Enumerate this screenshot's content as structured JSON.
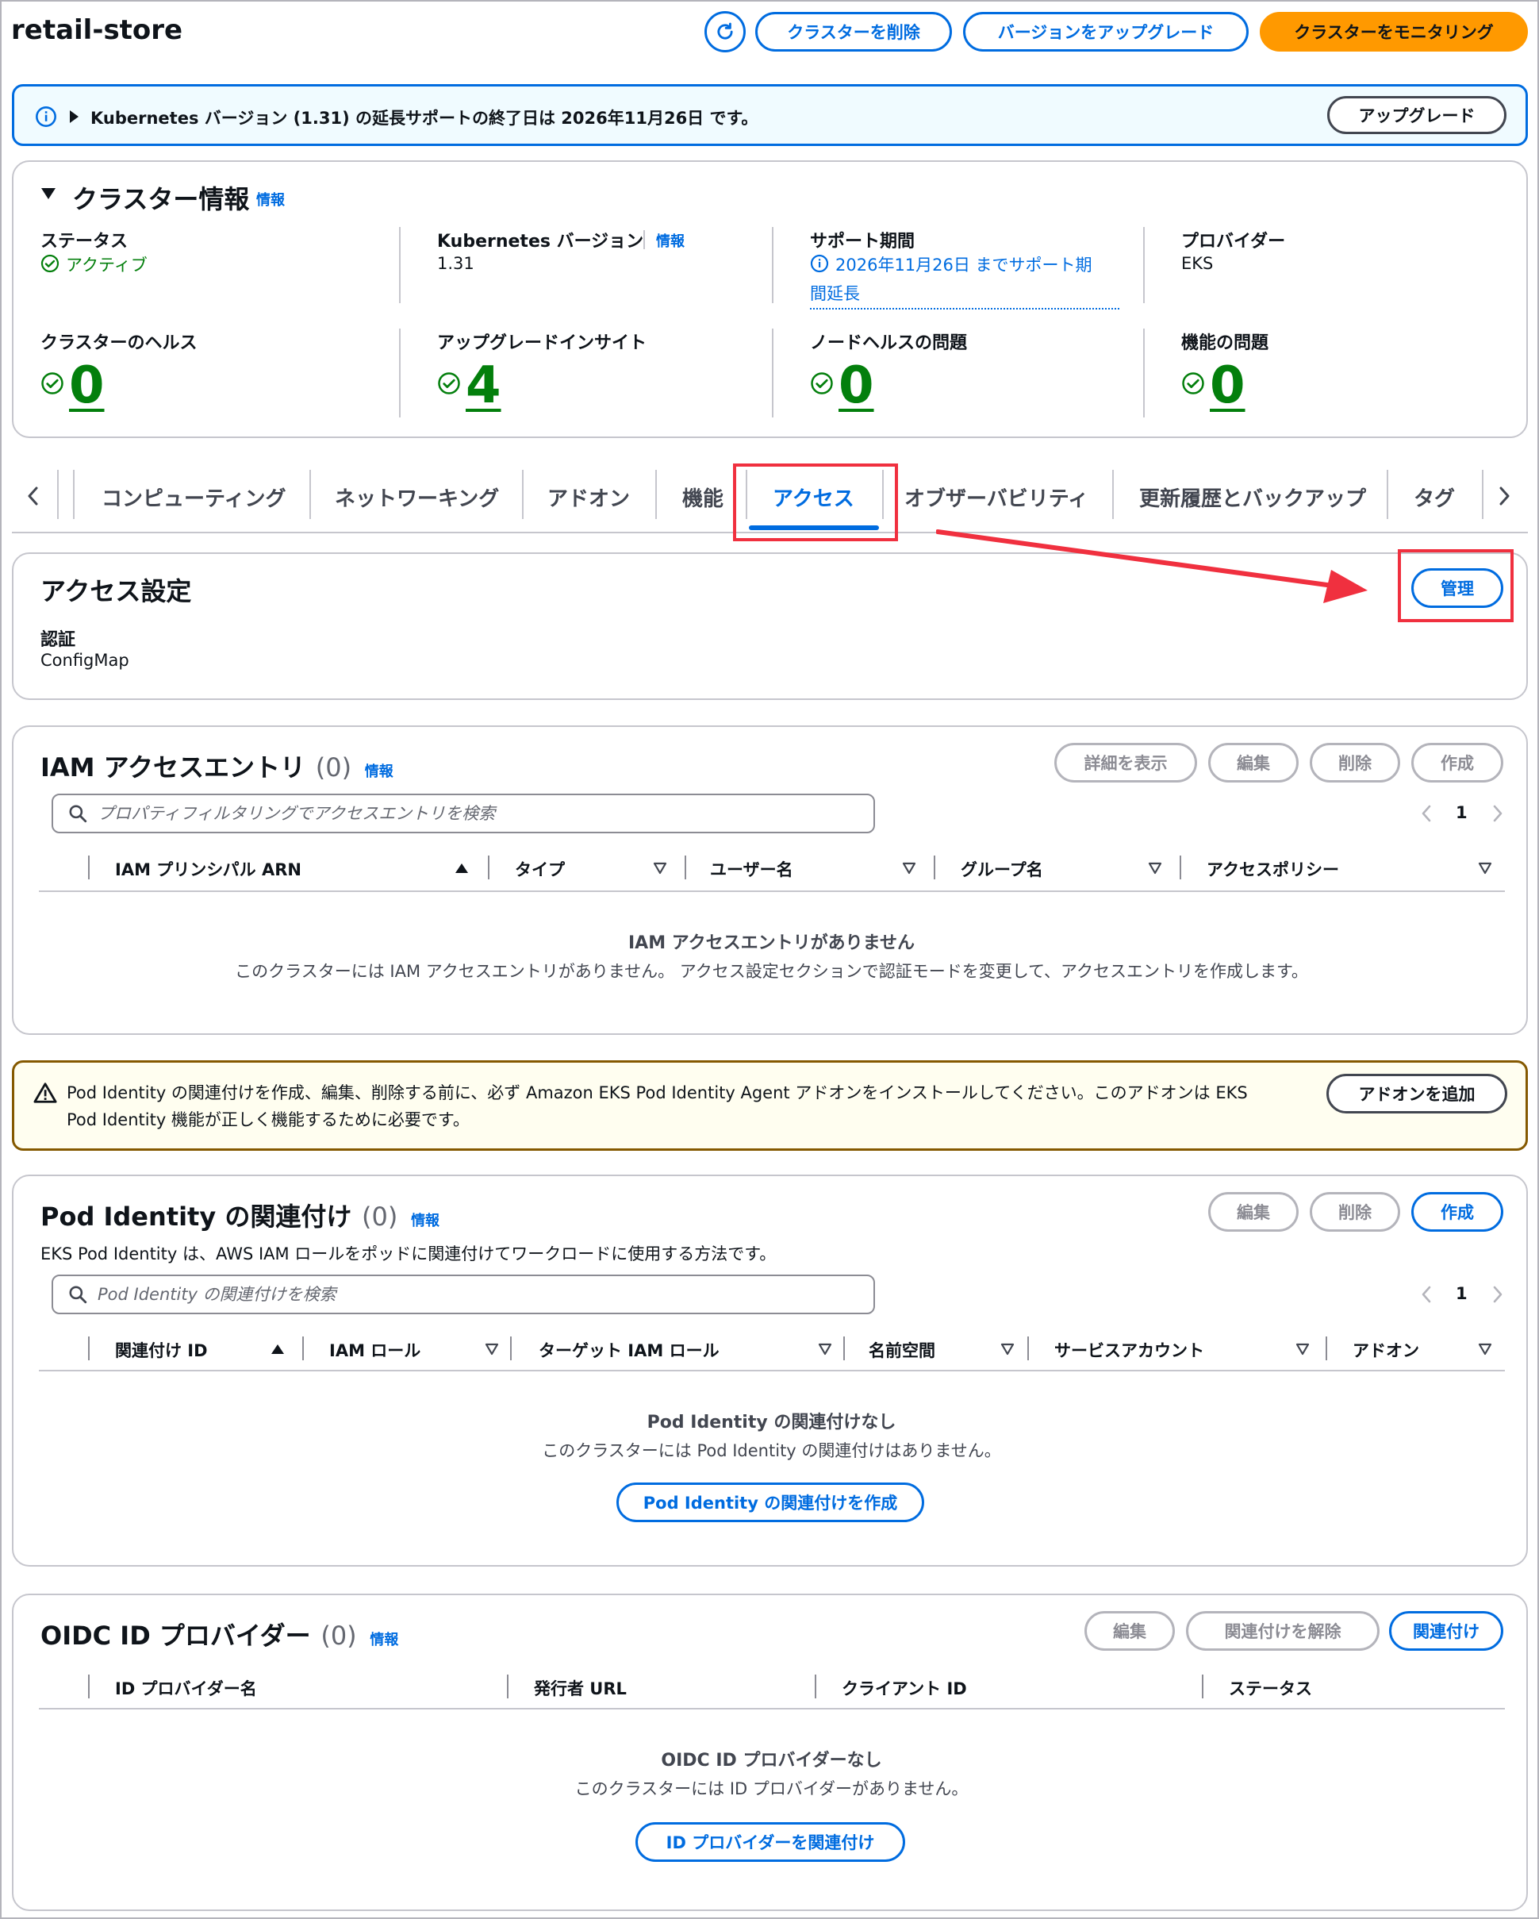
{
  "header": {
    "title": "retail-store",
    "refresh_icon": "refresh-icon",
    "delete_cluster": "クラスターを削除",
    "upgrade_version": "バージョンをアップグレード",
    "monitor_cluster": "クラスターをモニタリング"
  },
  "banner": {
    "text": "Kubernetes バージョン (1.31) の延長サポートの終了日は 2026年11月26日 です。",
    "button": "アップグレード"
  },
  "cluster_info": {
    "title": "クラスター情報",
    "info": "情報",
    "status_label": "ステータス",
    "status_value": "アクティブ",
    "k8s_label": "Kubernetes バージョン",
    "k8s_info": "情報",
    "k8s_value": "1.31",
    "support_label": "サポート期間",
    "support_value_1": "2026年11月26日 までサポート期",
    "support_value_2": "間延長",
    "provider_label": "プロバイダー",
    "provider_value": "EKS",
    "health_label": "クラスターのヘルス",
    "health_value": "0",
    "insight_label": "アップグレードインサイト",
    "insight_value": "4",
    "node_label": "ノードヘルスの問題",
    "node_value": "0",
    "feature_label": "機能の問題",
    "feature_value": "0"
  },
  "tabs": [
    {
      "label": "コンピューティング"
    },
    {
      "label": "ネットワーキング"
    },
    {
      "label": "アドオン"
    },
    {
      "label": "機能"
    },
    {
      "label": "アクセス"
    },
    {
      "label": "オブザーバビリティ"
    },
    {
      "label": "更新履歴とバックアップ"
    },
    {
      "label": "タグ"
    }
  ],
  "active_tab": "アクセス",
  "access_settings": {
    "title": "アクセス設定",
    "manage": "管理",
    "auth_label": "認証",
    "auth_value": "ConfigMap"
  },
  "iam_entries": {
    "title": "IAM アクセスエントリ",
    "count": "(0)",
    "info": "情報",
    "btn_details": "詳細を表示",
    "btn_edit": "編集",
    "btn_delete": "削除",
    "btn_create": "作成",
    "search_placeholder": "プロパティフィルタリングでアクセスエントリを検索",
    "page": "1",
    "columns": [
      "IAM プリンシパル ARN",
      "タイプ",
      "ユーザー名",
      "グループ名",
      "アクセスポリシー"
    ],
    "empty_title": "IAM アクセスエントリがありません",
    "empty_desc": "このクラスターには IAM アクセスエントリがありません。 アクセス設定セクションで認証モードを変更して、アクセスエントリを作成します。"
  },
  "warning": {
    "line1": "Pod Identity の関連付けを作成、編集、削除する前に、必ず Amazon EKS Pod Identity Agent アドオンをインストールしてください。このアドオンは EKS",
    "line2": "Pod Identity 機能が正しく機能するために必要です。",
    "button": "アドオンを追加"
  },
  "pod_identity": {
    "title": "Pod Identity の関連付け",
    "count": "(0)",
    "info": "情報",
    "desc": "EKS Pod Identity は、AWS IAM ロールをポッドに関連付けてワークロードに使用する方法です。",
    "btn_edit": "編集",
    "btn_delete": "削除",
    "btn_create": "作成",
    "search_placeholder": "Pod Identity の関連付けを検索",
    "page": "1",
    "columns": [
      "関連付け ID",
      "IAM ロール",
      "ターゲット IAM ロール",
      "名前空間",
      "サービスアカウント",
      "アドオン"
    ],
    "empty_title": "Pod Identity の関連付けなし",
    "empty_desc": "このクラスターには Pod Identity の関連付けはありません。",
    "empty_button": "Pod Identity の関連付けを作成"
  },
  "oidc": {
    "title": "OIDC ID プロバイダー",
    "count": "(0)",
    "info": "情報",
    "btn_edit": "編集",
    "btn_disassociate": "関連付けを解除",
    "btn_associate": "関連付け",
    "columns": [
      "ID プロバイダー名",
      "発行者 URL",
      "クライアント ID",
      "ステータス"
    ],
    "empty_title": "OIDC ID プロバイダーなし",
    "empty_desc": "このクラスターには ID プロバイダーがありません。",
    "empty_button": "ID プロバイダーを関連付け"
  },
  "colors": {
    "link_blue": "#006ce0",
    "success_green": "#037f0c",
    "primary_orange": "#ff9900",
    "annotation_red": "#f0303f",
    "info_bg": "#f0fbff",
    "warning_bg": "#fffef0"
  }
}
